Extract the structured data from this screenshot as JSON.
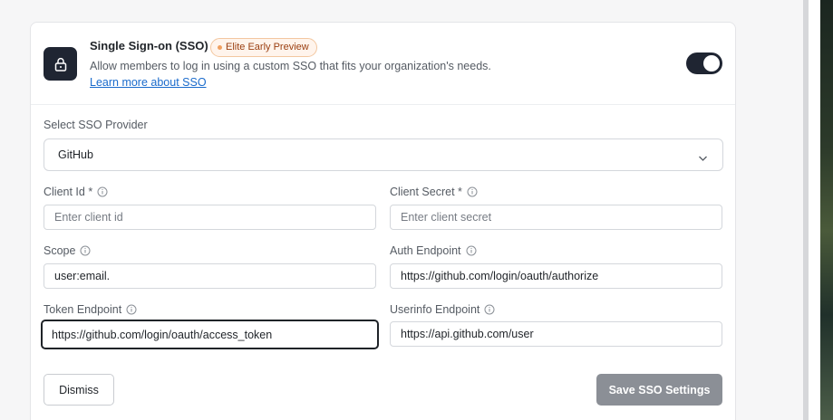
{
  "sso": {
    "title": "Single Sign-on (SSO)",
    "badge": "Elite Early Preview",
    "description": "Allow members to log in using a custom SSO that fits your organization's needs.",
    "learn_more": "Learn more about SSO",
    "enabled": true
  },
  "provider": {
    "label": "Select SSO Provider",
    "value": "GitHub"
  },
  "fields": {
    "client_id": {
      "label": "Client Id *",
      "placeholder": "Enter client id",
      "value": ""
    },
    "client_secret": {
      "label": "Client Secret *",
      "placeholder": "Enter client secret",
      "value": ""
    },
    "scope": {
      "label": "Scope",
      "placeholder": "",
      "value": "user:email."
    },
    "auth_endpoint": {
      "label": "Auth Endpoint",
      "placeholder": "",
      "value": "https://github.com/login/oauth/authorize"
    },
    "token_endpoint": {
      "label": "Token Endpoint",
      "placeholder": "",
      "value": "https://github.com/login/oauth/access_token"
    },
    "userinfo_endpoint": {
      "label": "Userinfo Endpoint",
      "placeholder": "",
      "value": "https://api.github.com/user"
    }
  },
  "actions": {
    "dismiss": "Dismiss",
    "save": "Save SSO Settings"
  },
  "icons": {
    "lock": "lock-icon",
    "info": "info-icon",
    "chevron": "chevron-down-icon"
  },
  "colors": {
    "accent_dark": "#1f2532",
    "link": "#1a6bcc",
    "badge_bg": "#fff4ec",
    "badge_text": "#9a3e10",
    "save_disabled": "#8b8f96"
  }
}
